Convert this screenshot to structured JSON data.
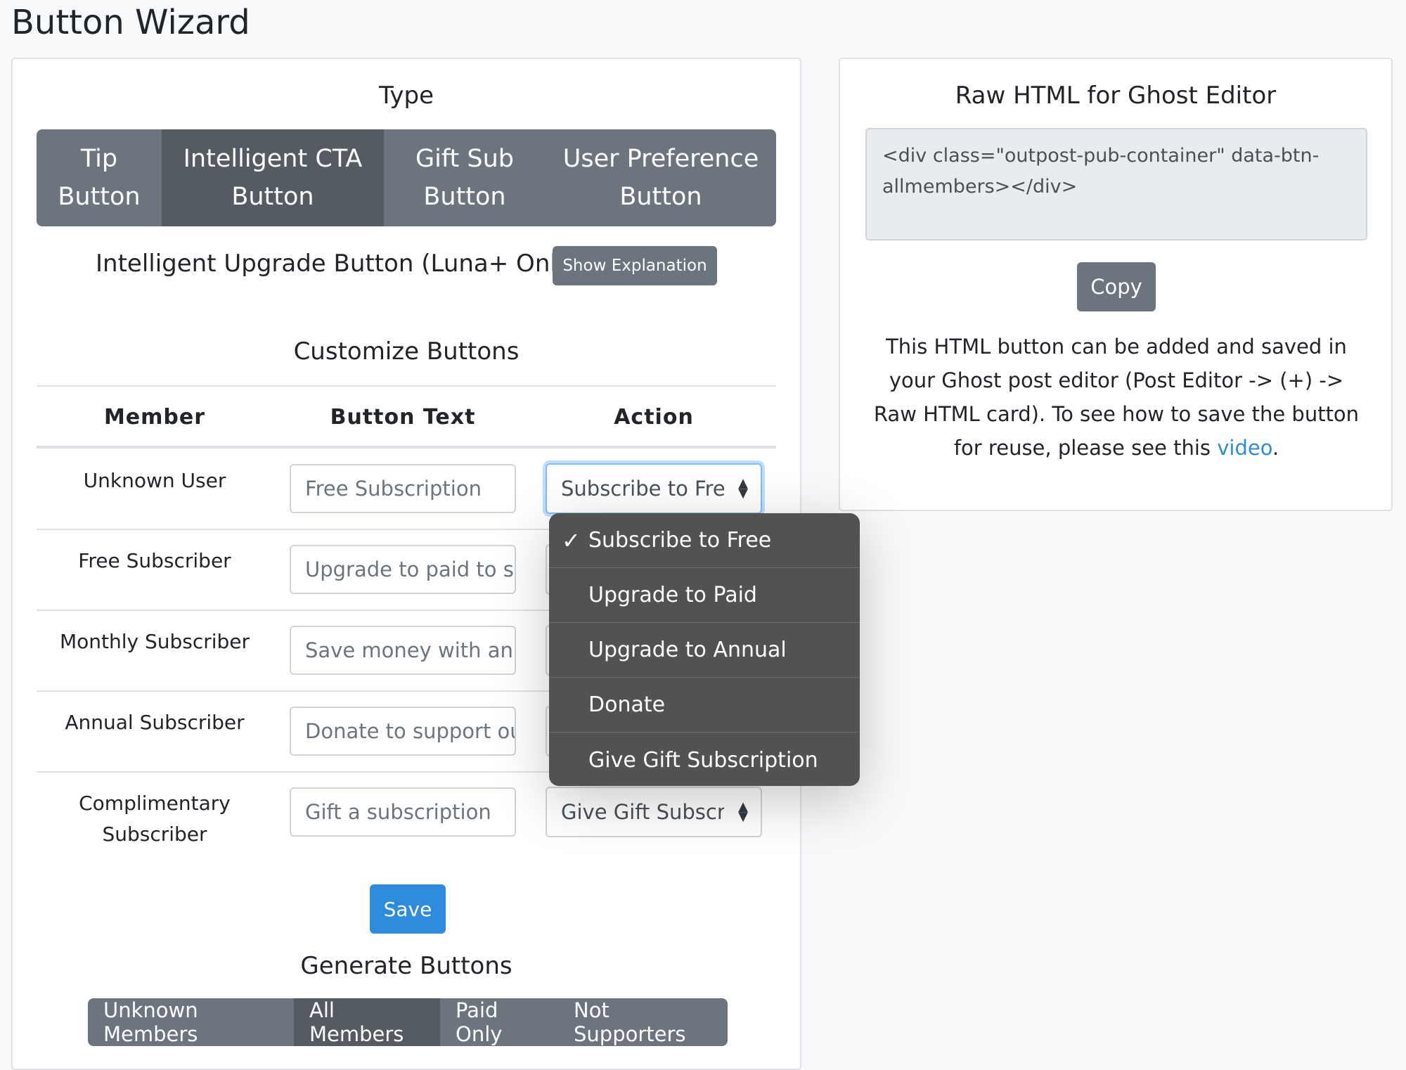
{
  "page_title": "Button Wizard",
  "type_section": {
    "heading": "Type",
    "tabs": [
      {
        "line1": "Tip",
        "line2": "Button"
      },
      {
        "line1": "Intelligent CTA",
        "line2": "Button"
      },
      {
        "line1": "Gift Sub",
        "line2": "Button"
      },
      {
        "line1": "User Preference",
        "line2": "Button"
      }
    ],
    "active_index": 1
  },
  "upgrade": {
    "label": "Intelligent Upgrade Button (Luna+ Only)",
    "explain_button": "Show Explanation"
  },
  "customize": {
    "heading": "Customize Buttons",
    "columns": [
      "Member",
      "Button Text",
      "Action"
    ],
    "rows": [
      {
        "member": "Unknown User",
        "text": "Free Subscription",
        "action": "Subscribe to Free"
      },
      {
        "member": "Free Subscriber",
        "text": "Upgrade to paid to se",
        "action": ""
      },
      {
        "member": "Monthly Subscriber",
        "text": "Save money with an a",
        "action": ""
      },
      {
        "member": "Annual Subscriber",
        "text": "Donate to support oui",
        "action": ""
      },
      {
        "member_line1": "Complimentary",
        "member_line2": "Subscriber",
        "text": "Gift a subscription",
        "action": "Give Gift Subscripti"
      }
    ],
    "save_button": "Save"
  },
  "generate": {
    "heading": "Generate Buttons",
    "options": [
      "Unknown Members",
      "All Members",
      "Paid Only",
      "Not Supporters"
    ],
    "active_index": 1
  },
  "raw_html": {
    "heading": "Raw HTML for Ghost Editor",
    "code": "<div class=\"outpost-pub-container\" data-btn-allmembers></div>",
    "copy_button": "Copy",
    "info_text": "This HTML button can be added and saved in your Ghost post editor (Post Editor -> (+) -> Raw HTML card). To see how to save the button for reuse, please see this ",
    "link_text": "video",
    "info_end": "."
  },
  "action_menu": {
    "options": [
      "Subscribe to Free",
      "Upgrade to Paid",
      "Upgrade to Annual",
      "Donate",
      "Give Gift Subscription"
    ],
    "selected": "Subscribe to Free"
  },
  "colors": {
    "gray_button": "#6c757d",
    "active_button": "#545b62",
    "primary_blue": "#2e8bde",
    "menu_bg": "#525252"
  }
}
